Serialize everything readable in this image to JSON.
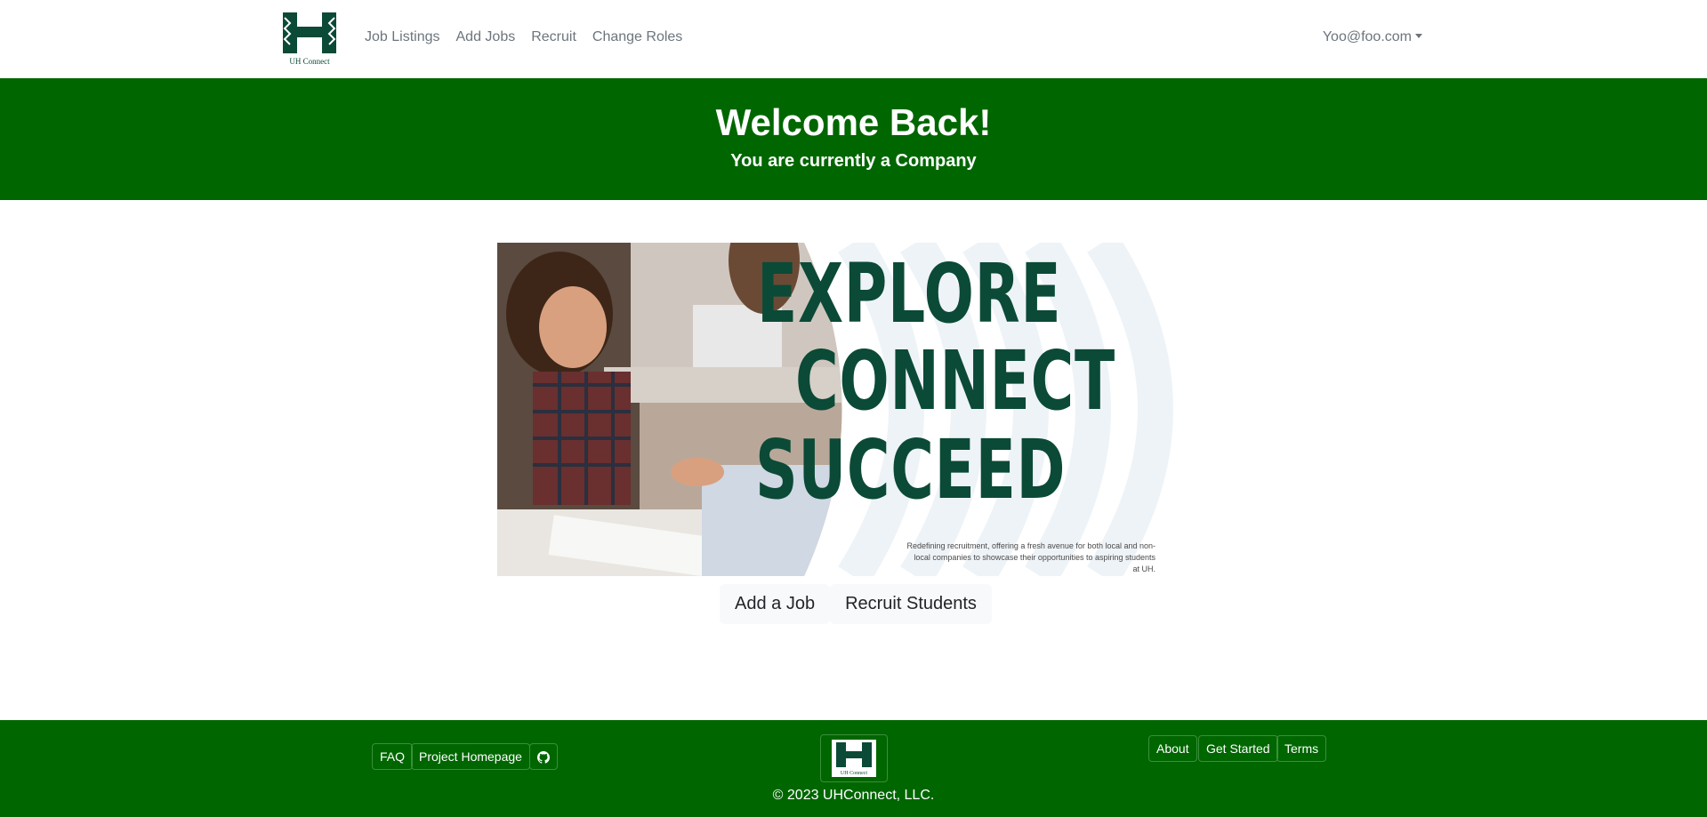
{
  "nav": {
    "logo_text": "UH Connect",
    "links": [
      "Job Listings",
      "Add Jobs",
      "Recruit",
      "Change Roles"
    ],
    "user": "Yoo@foo.com"
  },
  "hero": {
    "title": "Welcome Back!",
    "subtitle": "You are currently a Company"
  },
  "banner": {
    "words": [
      "EXPLORE",
      "CONNECT",
      "SUCCEED"
    ],
    "tagline": "Redefining recruitment, offering a fresh avenue for both local and non-local companies to showcase their opportunities to aspiring students at UH."
  },
  "actions": {
    "add_job": "Add a Job",
    "recruit": "Recruit Students"
  },
  "footer": {
    "left_links": [
      "FAQ",
      "Project Homepage"
    ],
    "right_links": [
      "About",
      "Get Started",
      "Terms"
    ],
    "logo_text": "UH Connect",
    "copyright": "© 2023 UHConnect, LLC."
  },
  "colors": {
    "brand_green": "#006600",
    "banner_text": "#0b4a36"
  }
}
